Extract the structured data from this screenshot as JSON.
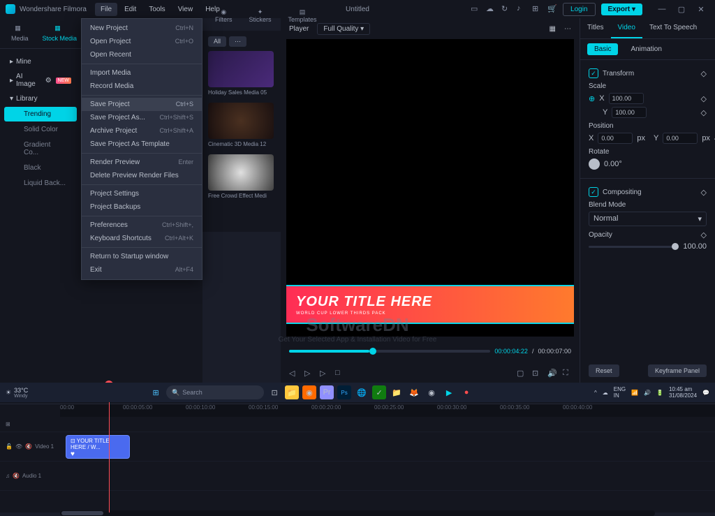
{
  "app": {
    "name": "Wondershare Filmora",
    "title": "Untitled",
    "login": "Login",
    "export": "Export"
  },
  "menus": [
    "File",
    "Edit",
    "Tools",
    "View",
    "Help"
  ],
  "filemenu": [
    {
      "label": "New Project",
      "short": "Ctrl+N"
    },
    {
      "label": "Open Project",
      "short": "Ctrl+O"
    },
    {
      "label": "Open Recent",
      "short": ""
    },
    null,
    {
      "label": "Import Media",
      "short": ""
    },
    {
      "label": "Record Media",
      "short": ""
    },
    null,
    {
      "label": "Save Project",
      "short": "Ctrl+S",
      "hl": true
    },
    {
      "label": "Save Project As...",
      "short": "Ctrl+Shift+S"
    },
    {
      "label": "Archive Project",
      "short": "Ctrl+Shift+A"
    },
    {
      "label": "Save Project As Template",
      "short": ""
    },
    null,
    {
      "label": "Render Preview",
      "short": "Enter"
    },
    {
      "label": "Delete Preview Render Files",
      "short": ""
    },
    null,
    {
      "label": "Project Settings",
      "short": ""
    },
    {
      "label": "Project Backups",
      "short": ""
    },
    null,
    {
      "label": "Preferences",
      "short": "Ctrl+Shift+,"
    },
    {
      "label": "Keyboard Shortcuts",
      "short": "Ctrl+Alt+K"
    },
    null,
    {
      "label": "Return to Startup window",
      "short": ""
    },
    {
      "label": "Exit",
      "short": "Alt+F4"
    }
  ],
  "panelTabs": [
    "Media",
    "Stock Media"
  ],
  "assetTabs": [
    "Filters",
    "Stickers",
    "Templates"
  ],
  "sidebar": {
    "items": [
      "Mine",
      "AI Image",
      "Library"
    ],
    "subs": [
      "Trending",
      "Solid Color",
      "Gradient Co...",
      "Black",
      "Liquid Back..."
    ]
  },
  "media": {
    "filter": "All",
    "items": [
      {
        "label": "Holiday Sales Media 05"
      },
      {
        "label": "Cinematic 3D Media 12"
      },
      {
        "label": "Free Crowd Effect Medi"
      }
    ]
  },
  "player": {
    "label": "Player",
    "quality": "Full Quality",
    "title": "YOUR TITLE HERE",
    "subtitle": "WORLD CUP LOWER THIRDS PACK",
    "current": "00:00:04:22",
    "total": "00:00:07:00"
  },
  "props": {
    "tabs": [
      "Titles",
      "Video",
      "Text To Speech"
    ],
    "subtabs": [
      "Basic",
      "Animation"
    ],
    "transform": "Transform",
    "scale": "Scale",
    "scaleX": "100.00",
    "scaleY": "100.00",
    "position": "Position",
    "posX": "0.00",
    "posY": "0.00",
    "px": "px",
    "rotate": "Rotate",
    "rotVal": "0.00°",
    "compositing": "Compositing",
    "blend": "Blend Mode",
    "blendVal": "Normal",
    "opacity": "Opacity",
    "opacityVal": "100.00",
    "reset": "Reset",
    "keyframe": "Keyframe Panel"
  },
  "timeline": {
    "ticks": [
      "00:00",
      "00:00:05:00",
      "00:00:10:00",
      "00:00:15:00",
      "00:00:20:00",
      "00:00:25:00",
      "00:00:30:00",
      "00:00:35:00",
      "00:00:40:00"
    ],
    "video": "Video 1",
    "audio": "Audio 1",
    "clip": "YOUR TITLE HERE / W..."
  },
  "watermark": {
    "l1": "SoftwareDN",
    "l2": "Get Your Selected App & Installation Video for Free"
  },
  "taskbar": {
    "temp": "33°C",
    "cond": "Windy",
    "search": "Search",
    "lang": "ENG",
    "region": "IN",
    "time": "10:45 am",
    "date": "31/08/2024"
  }
}
